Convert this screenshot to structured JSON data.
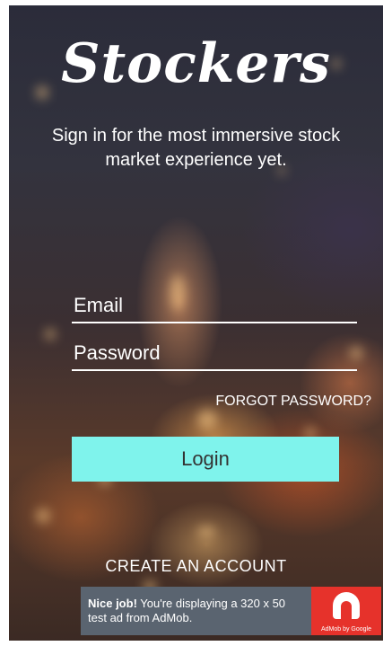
{
  "app": {
    "logo_text": "Stockers",
    "tagline": "Sign in for the most immersive stock market experience yet."
  },
  "login_form": {
    "email_placeholder": "Email",
    "password_placeholder": "Password",
    "forgot_password_label": "FORGOT PASSWORD?",
    "login_label": "Login",
    "create_account_label": "CREATE AN ACCOUNT"
  },
  "ad": {
    "headline": "Nice job!",
    "body": "You're displaying a 320 x 50 test ad from AdMob.",
    "brand": "AdMob by Google",
    "icon": "admob-logo-icon"
  },
  "colors": {
    "login_button": "#7ff3ec",
    "ad_logo": "#e6322b",
    "ad_background": "#5a6470"
  }
}
